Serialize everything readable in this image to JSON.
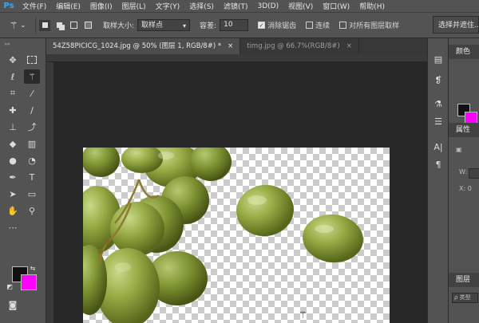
{
  "app": {
    "logo": "Ps"
  },
  "menu": [
    "文件(F)",
    "编辑(E)",
    "图像(I)",
    "图层(L)",
    "文字(Y)",
    "选择(S)",
    "滤镜(T)",
    "3D(D)",
    "视图(V)",
    "窗口(W)",
    "帮助(H)"
  ],
  "options": {
    "tool_icon": "magic-wand-icon",
    "sample_size_label": "取样大小:",
    "sample_size_value": "取样点",
    "tolerance_label": "容差:",
    "tolerance_value": "10",
    "anti_alias_label": "消除锯齿",
    "anti_alias_checked": true,
    "contiguous_label": "连续",
    "contiguous_checked": false,
    "all_layers_label": "对所有图层取样",
    "all_layers_checked": false,
    "select_mask_label": "选择并遮住..."
  },
  "tabs": [
    {
      "title": "54Z58PICICG_1024.jpg @ 50% (图层 1, RGB/8#) *",
      "close": "×",
      "active": true
    },
    {
      "title": "timg.jpg @ 66.7%(RGB/8#)",
      "close": "×",
      "active": false
    }
  ],
  "colors": {
    "foreground": "#111111",
    "background": "#ff00ff"
  },
  "right_panel": {
    "color_title": "颜色",
    "properties_title": "属性",
    "w_label": "W:",
    "x_label": "X: 0",
    "layers_title": "图层",
    "search_placeholder": "ρ 类型"
  }
}
